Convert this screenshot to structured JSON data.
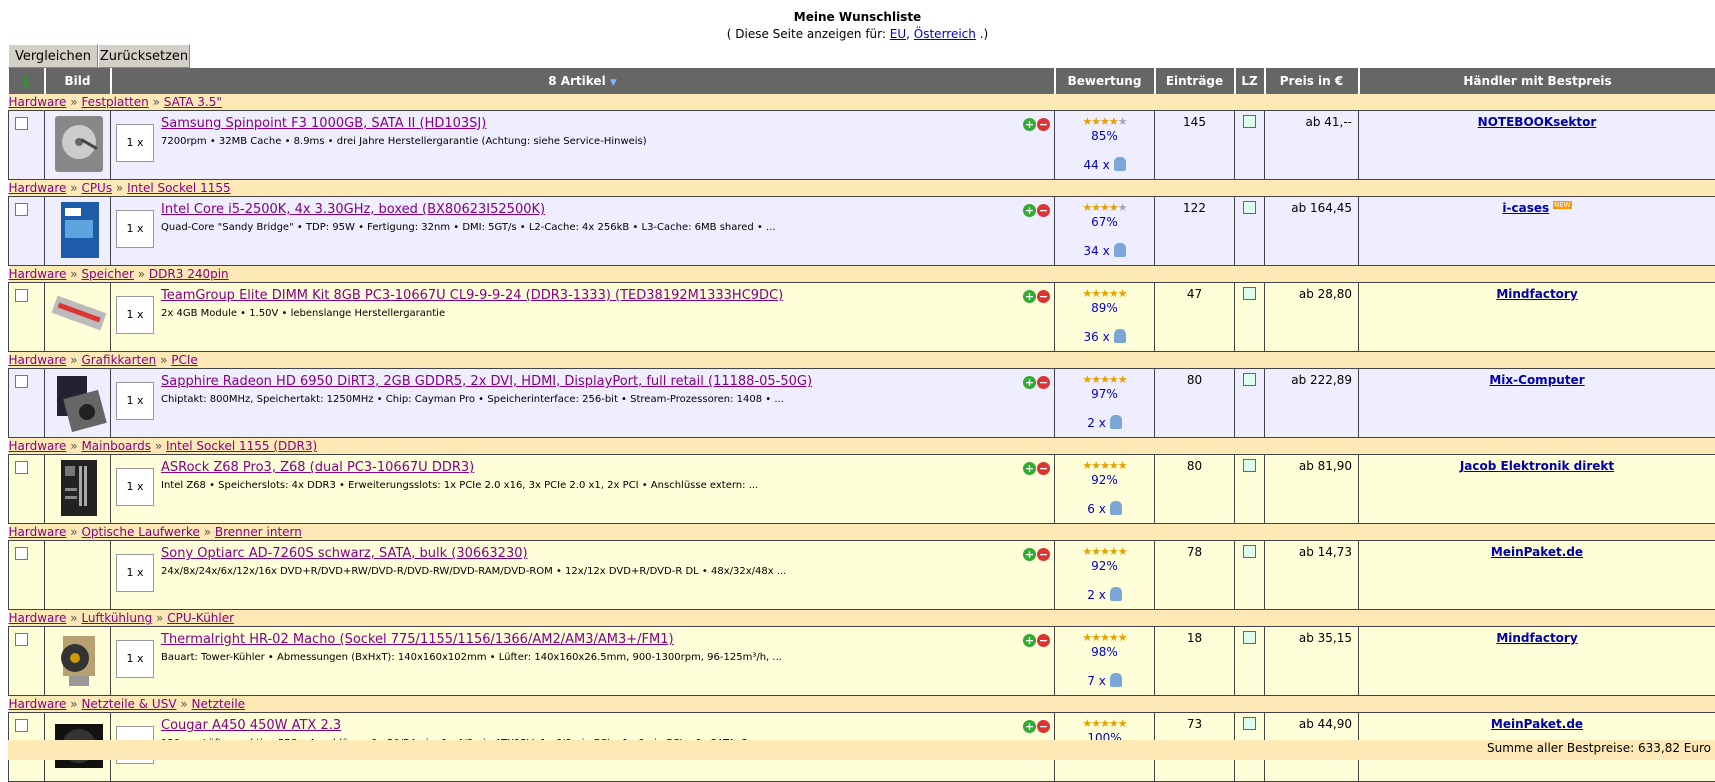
{
  "page": {
    "title": "Meine Wunschliste",
    "subtitle_prefix": "( Diese Seite anzeigen für:",
    "subtitle_link1": "EU",
    "subtitle_sep": ",",
    "subtitle_link2": "Österreich",
    "subtitle_suffix": ".)"
  },
  "toolbar": {
    "compare_label": "Vergleichen",
    "reset_label": "Zurücksetzen"
  },
  "table_header": {
    "bild": "Bild",
    "artikel": "8 Artikel",
    "bewertung": "Bewertung",
    "eintraege": "Einträge",
    "lz": "LZ",
    "preis": "Preis in €",
    "haendler": "Händler mit Bestpreis"
  },
  "items": [
    {
      "cat": [
        "Hardware",
        "Festplatten",
        "SATA 3.5\""
      ],
      "qty": "1 x",
      "name": "Samsung Spinpoint F3 1000GB, SATA II (HD103SJ)",
      "desc": "7200rpm • 32MB Cache • 8.9ms • drei Jahre Herstellergarantie (Achtung: siehe Service-Hinweis)",
      "stars": 4,
      "stars_half": false,
      "pct": "85%",
      "count": "44 x",
      "entries": "145",
      "price": "ab 41,--",
      "dealer": "NOTEBOOKsektor",
      "dealer_new": false,
      "bg": "b",
      "icon": "hdd-image"
    },
    {
      "cat": [
        "Hardware",
        "CPUs",
        "Intel Sockel 1155"
      ],
      "qty": "1 x",
      "name": "Intel Core i5-2500K, 4x 3.30GHz, boxed (BX80623I52500K)",
      "desc": "Quad-Core \"Sandy Bridge\" • TDP: 95W • Fertigung: 32nm • DMI: 5GT/s • L2-Cache: 4x 256kB • L3-Cache: 6MB shared • ...",
      "stars": 4,
      "stars_half": false,
      "pct": "67%",
      "count": "34 x",
      "entries": "122",
      "price": "ab 164,45",
      "dealer": "i-cases",
      "dealer_new": true,
      "bg": "b",
      "icon": "cpu-box-image"
    },
    {
      "cat": [
        "Hardware",
        "Speicher",
        "DDR3 240pin"
      ],
      "qty": "1 x",
      "name": "TeamGroup Elite DIMM Kit 8GB PC3-10667U CL9-9-9-24 (DDR3-1333) (TED38192M1333HC9DC)",
      "desc": "2x 4GB Module • 1.50V • lebenslange Herstellergarantie",
      "stars": 5,
      "stars_half": false,
      "pct": "89%",
      "count": "36 x",
      "entries": "47",
      "price": "ab 28,80",
      "dealer": "Mindfactory",
      "dealer_new": false,
      "bg": "y",
      "icon": "ram-image"
    },
    {
      "cat": [
        "Hardware",
        "Grafikkarten",
        "PCIe"
      ],
      "qty": "1 x",
      "name": "Sapphire Radeon HD 6950 DiRT3, 2GB GDDR5, 2x DVI, HDMI, DisplayPort, full retail (11188-05-50G)",
      "desc": "Chiptakt: 800MHz, Speichertakt: 1250MHz • Chip: Cayman Pro • Speicherinterface: 256-bit • Stream-Prozessoren: 1408 • ...",
      "stars": 5,
      "stars_half": false,
      "pct": "97%",
      "count": "2 x",
      "entries": "80",
      "price": "ab 222,89",
      "dealer": "Mix-Computer",
      "dealer_new": false,
      "bg": "b",
      "icon": "gpu-image"
    },
    {
      "cat": [
        "Hardware",
        "Mainboards",
        "Intel Sockel 1155 (DDR3)"
      ],
      "qty": "1 x",
      "name": "ASRock Z68 Pro3, Z68 (dual PC3-10667U DDR3)",
      "desc": "Intel Z68 • Speicherslots: 4x DDR3 • Erweiterungsslots: 1x PCIe 2.0 x16, 3x PCIe 2.0 x1, 2x PCI • Anschlüsse extern: ...",
      "stars": 5,
      "stars_half": false,
      "pct": "92%",
      "count": "6 x",
      "entries": "80",
      "price": "ab 81,90",
      "dealer": "Jacob Elektronik direkt",
      "dealer_new": false,
      "bg": "y",
      "icon": "mainboard-image"
    },
    {
      "cat": [
        "Hardware",
        "Optische Laufwerke",
        "Brenner intern"
      ],
      "qty": "1 x",
      "name": "Sony Optiarc AD-7260S schwarz, SATA, bulk (30663230)",
      "desc": "24x/8x/24x/6x/12x/16x DVD+R/DVD+RW/DVD-R/DVD-RW/DVD-RAM/DVD-ROM • 12x/12x DVD+R/DVD-R DL • 48x/32x/48x ...",
      "stars": 5,
      "stars_half": false,
      "pct": "92%",
      "count": "2 x",
      "entries": "78",
      "price": "ab 14,73",
      "dealer": "MeinPaket.de",
      "dealer_new": false,
      "bg": "y",
      "icon": ""
    },
    {
      "cat": [
        "Hardware",
        "Luftkühlung",
        "CPU-Kühler"
      ],
      "qty": "1 x",
      "name": "Thermalright HR-02 Macho (Sockel 775/1155/1156/1366/AM2/AM3/AM3+/FM1)",
      "desc": "Bauart: Tower-Kühler • Abmessungen (BxHxT): 140x160x102mm • Lüfter: 140x160x26.5mm, 900-1300rpm, 96-125m³/h, ...",
      "stars": 5,
      "stars_half": false,
      "pct": "98%",
      "count": "7 x",
      "entries": "18",
      "price": "ab 35,15",
      "dealer": "Mindfactory",
      "dealer_new": false,
      "bg": "y",
      "icon": "cooler-image"
    },
    {
      "cat": [
        "Hardware",
        "Netzteile & USV",
        "Netzteile"
      ],
      "qty": "1 x",
      "name": "Cougar A450 450W ATX 2.3",
      "desc": "120mm Lüfter • aktive PFC • Anschlüsse: 1x 20/24-pin, 1x 4/8-pin ATX12V, 1x 6/8-pin PCIe, 1x 6-pin PCIe, 6x SATA, 3x ...",
      "stars": 5,
      "stars_half": false,
      "pct": "100%",
      "count": "",
      "entries": "73",
      "price": "ab 44,90",
      "dealer": "MeinPaket.de",
      "dealer_new": false,
      "bg": "y",
      "icon": "psu-image"
    }
  ],
  "footer": {
    "total": "Summe aller Bestpreise: 633,82 Euro"
  },
  "badge_new": "NEW"
}
